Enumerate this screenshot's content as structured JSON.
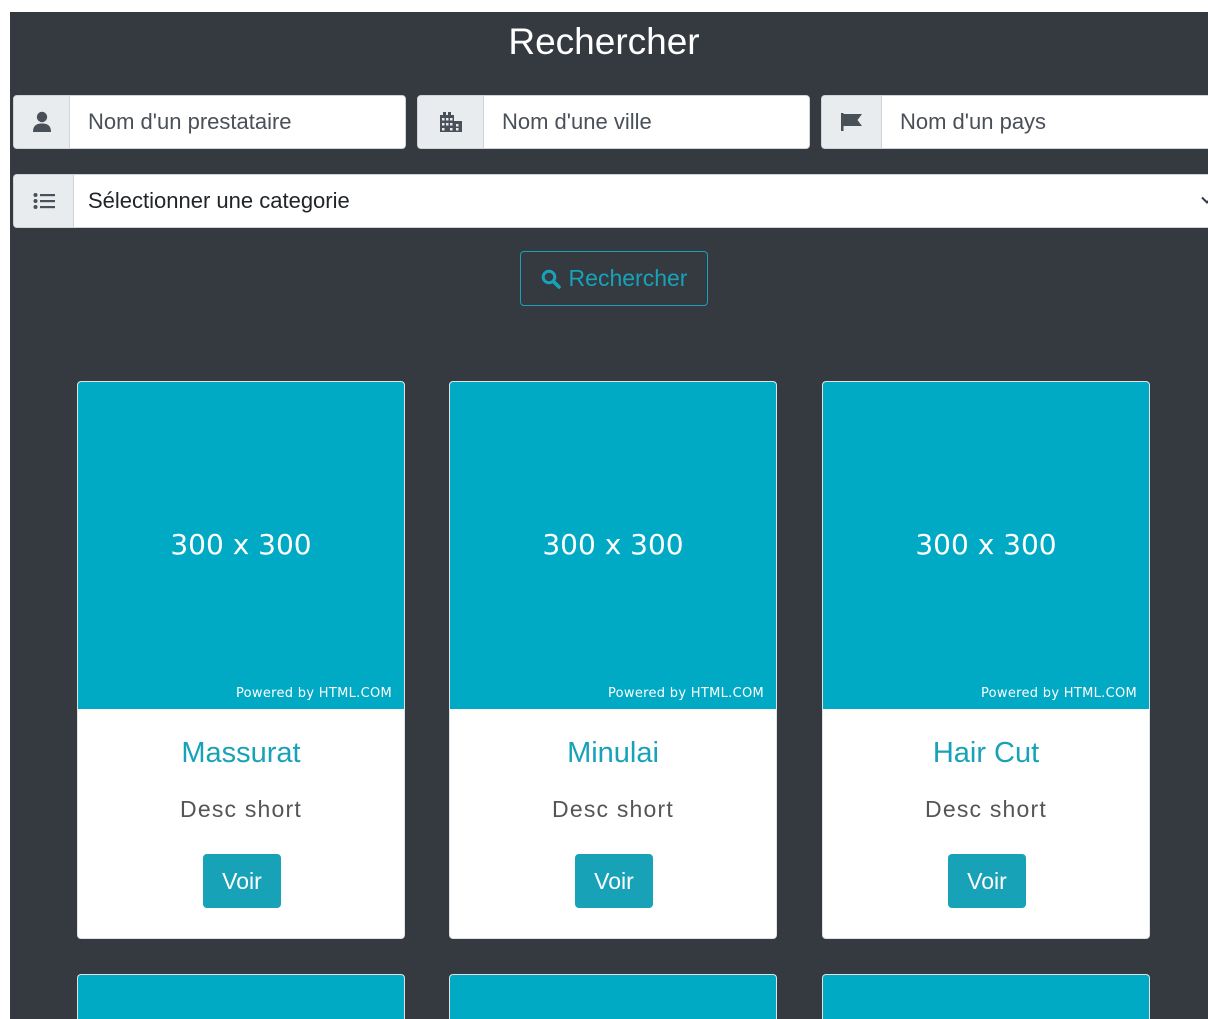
{
  "header": {
    "title": "Rechercher"
  },
  "filters": {
    "provider_placeholder": "Nom d'un prestataire",
    "city_placeholder": "Nom d'une ville",
    "country_placeholder": "Nom d'un pays",
    "category_selected": "Sélectionner une categorie"
  },
  "search_button": {
    "label": "Rechercher"
  },
  "cards": [
    {
      "image_size": "300 x 300",
      "image_credit": "Powered by HTML.COM",
      "title": "Massurat",
      "desc": "Desc short",
      "button": "Voir"
    },
    {
      "image_size": "300 x 300",
      "image_credit": "Powered by HTML.COM",
      "title": "Minulai",
      "desc": "Desc short",
      "button": "Voir"
    },
    {
      "image_size": "300 x 300",
      "image_credit": "Powered by HTML.COM",
      "title": "Hair Cut",
      "desc": "Desc short",
      "button": "Voir"
    }
  ],
  "icons": {
    "provider": "user-icon",
    "city": "city-icon",
    "country": "flag-icon",
    "category": "list-icon",
    "dropdown": "chevron-down-icon",
    "search": "search-icon"
  },
  "colors": {
    "background": "#343a40",
    "accent": "#17a2b8",
    "image_placeholder": "#00a9c4",
    "addon": "#e9ecef"
  }
}
